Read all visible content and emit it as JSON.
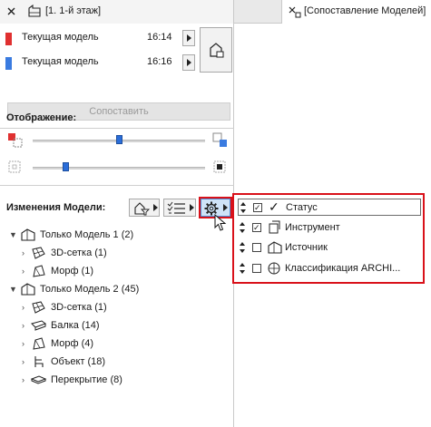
{
  "tabs": {
    "left_label": "[1. 1-й этаж]",
    "right_label": "[Сопоставление Моделей]"
  },
  "models": {
    "rows": [
      {
        "label": "Текущая модель",
        "time": "16:14",
        "color": "#e03030"
      },
      {
        "label": "Текущая модель",
        "time": "16:16",
        "color": "#3a7be0"
      }
    ]
  },
  "compare_label": "Сопоставить",
  "display": {
    "title": "Отображение:",
    "slider1_level": 0.5,
    "slider2_level": 0.18
  },
  "changes": {
    "title": "Изменения Модели:"
  },
  "tree": {
    "groups": [
      {
        "label": "Только Модель 1 (2)",
        "items": [
          "3D-сетка (1)",
          "Морф (1)"
        ]
      },
      {
        "label": "Только Модель 2 (45)",
        "items": [
          "3D-сетка (1)",
          "Балка (14)",
          "Морф (4)",
          "Объект (18)",
          "Перекрытие (8)"
        ]
      }
    ]
  },
  "popup": {
    "rows": [
      {
        "label": "Статус",
        "checked": true
      },
      {
        "label": "Инструмент",
        "checked": true
      },
      {
        "label": "Источник",
        "checked": false
      },
      {
        "label": "Классификация ARCHI...",
        "checked": false
      }
    ]
  },
  "colors": {
    "highlight_red": "#d9111a",
    "accent_blue": "#2a6dd9"
  }
}
